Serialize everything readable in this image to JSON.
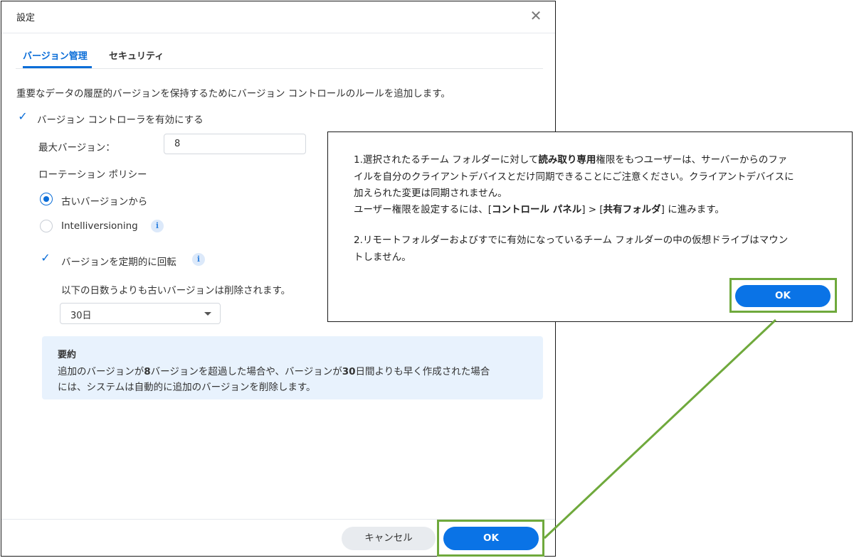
{
  "dialog": {
    "title": "設定",
    "close_label": "✕",
    "tabs": [
      {
        "label": "バージョン管理"
      },
      {
        "label": "セキュリティ"
      }
    ],
    "description": "重要なデータの履歴的バージョンを保持するためにバージョン コントロールのルールを追加します。",
    "enable_label": "バージョン コントローラを有効にする",
    "max_versions_label": "最大バージョン：",
    "max_versions_value": "8",
    "rotation_policy_label": "ローテーション ポリシー",
    "policy_options": [
      {
        "label": "古いバージョンから",
        "selected": true
      },
      {
        "label": "Intelliversioning",
        "selected": false
      }
    ],
    "rotate_label": "バージョンを定期的に回転",
    "delete_note": "以下の日数うよりも古いバージョンは削除されます。",
    "days_selected": "30日",
    "summary": {
      "title": "要約",
      "line1_a": "追加のバージョンが",
      "line1_b": "8",
      "line1_c": "バージョンを超過した場合や、バージョンが",
      "line1_d": "30",
      "line1_e": "日間よりも早く作成された場合",
      "line2": "には、システムは自動的に追加のバージョンを削除します。"
    },
    "cancel_label": "キャンセル",
    "ok_label": "OK"
  },
  "popup": {
    "l1_a": "1.選択されたるチーム フォルダーに対して",
    "l1_b": "読み取り専用",
    "l1_c": "権限をもつユーザーは、サーバーからのファ",
    "l2": "イルを自分のクライアントデバイスとだけ同期できることにご注意ください。クライアントデバイスに",
    "l3": "加えられた変更は同期されません。",
    "l4_a": "ユーザー権限を設定するには、[",
    "l4_b": "コントロール パネル",
    "l4_c": "] > [",
    "l4_d": "共有フォルダ",
    "l4_e": "] に進みます。",
    "l5": "2.リモートフォルダーおよびすでに有効になっているチーム フォルダーの中の仮想ドライブはマウン",
    "l6": "トしません。",
    "ok_label": "OK"
  },
  "icons": {
    "check": "check-icon",
    "info": "info-icon",
    "close": "close-icon",
    "caret": "chevron-down-icon"
  },
  "colors": {
    "accent": "#0a73e6",
    "highlight": "#6fa93c",
    "summary_bg": "#e8f2fd"
  }
}
